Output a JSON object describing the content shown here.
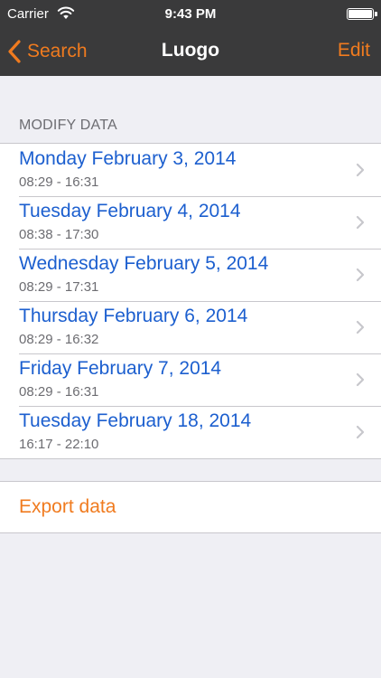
{
  "status_bar": {
    "carrier": "Carrier",
    "time": "9:43 PM"
  },
  "nav": {
    "back_label": "Search",
    "title": "Luogo",
    "edit_label": "Edit"
  },
  "section": {
    "header": "MODIFY DATA"
  },
  "entries": [
    {
      "date": "Monday February 3, 2014",
      "hours": "08:29 - 16:31"
    },
    {
      "date": "Tuesday February 4, 2014",
      "hours": "08:38 - 17:30"
    },
    {
      "date": "Wednesday February 5, 2014",
      "hours": "08:29 - 17:31"
    },
    {
      "date": "Thursday February 6, 2014",
      "hours": "08:29 - 16:32"
    },
    {
      "date": "Friday February 7, 2014",
      "hours": "08:29 - 16:31"
    },
    {
      "date": "Tuesday February 18, 2014",
      "hours": "16:17 - 22:10"
    }
  ],
  "actions": {
    "export_label": "Export data"
  },
  "colors": {
    "accent": "#f07b1f",
    "link": "#1c5fcf",
    "nav_bg": "#3a3a3b",
    "background": "#efeff4"
  }
}
